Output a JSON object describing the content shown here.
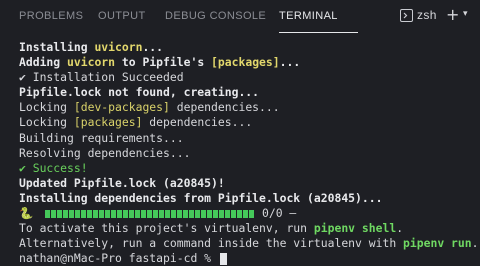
{
  "tabs": [
    {
      "label": "PROBLEMS",
      "active": false
    },
    {
      "label": "OUTPUT",
      "active": false
    },
    {
      "label": "DEBUG CONSOLE",
      "active": false
    },
    {
      "label": "TERMINAL",
      "active": true
    }
  ],
  "terminal_selector": {
    "label": "zsh",
    "icon": "terminal-icon"
  },
  "actions": {
    "new_terminal_icon": "plus-icon",
    "dropdown_icon": "chevron-down-icon"
  },
  "lines": {
    "l1a": "Installing ",
    "l1b": "uvicorn",
    "l1c": "...",
    "l2a": "Adding ",
    "l2b": "uvicorn",
    "l2c": " to Pipfile's ",
    "l2d": "[packages]",
    "l2e": "...",
    "l3": "✔ Installation Succeeded",
    "l4": "Pipfile.lock not found, creating...",
    "l5a": "Locking ",
    "l5b": "[dev-packages]",
    "l5c": " dependencies...",
    "l6a": "Locking ",
    "l6b": "[packages]",
    "l6c": " dependencies...",
    "l7": "Building requirements...",
    "l8": "Resolving dependencies...",
    "l9": "✔ Success!",
    "l10": "Updated Pipfile.lock (a20845)!",
    "l11": "Installing dependencies from Pipfile.lock (a20845)...",
    "l12_snake": "🐍",
    "l12_count": "0/0 —",
    "l13a": "To activate this project's virtualenv, run ",
    "l13b": "pipenv shell",
    "l13c": ".",
    "l14a": "Alternatively, run a command inside the virtualenv with ",
    "l14b": "pipenv run",
    "l14c": ".",
    "l15": "nathan@nMac-Pro fastapi-cd % "
  },
  "progress": {
    "fraction": 1.0
  },
  "colors": {
    "background": "#1e1f24",
    "green": "#69d15c",
    "yellow": "#d9d26a",
    "progress": "#45c85a"
  }
}
